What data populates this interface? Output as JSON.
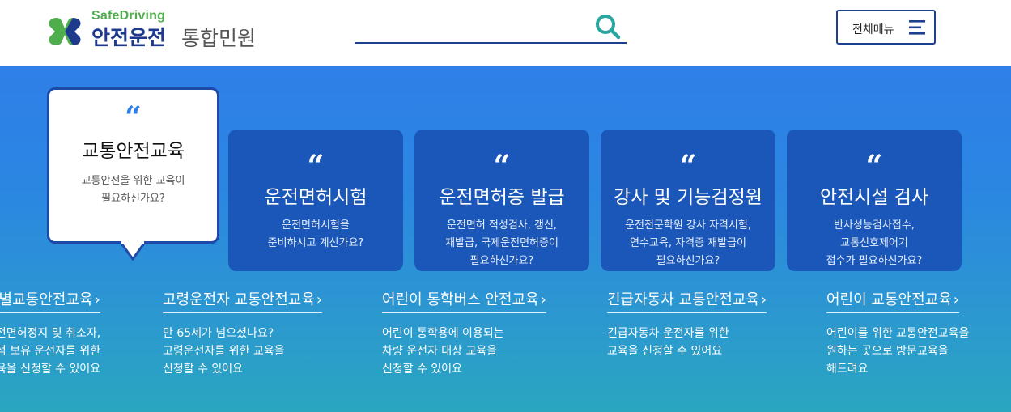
{
  "header": {
    "logo_sub": "SafeDriving",
    "logo_main": "안전운전",
    "logo_main_sub": "통합민원",
    "search_placeholder": "",
    "menu_label": "전체메뉴"
  },
  "colors": {
    "brand_navy": "#1c3f8f",
    "logo_green": "#4fae4c",
    "hero_top": "#2f7fe8",
    "hero_bottom": "#2aa6c0",
    "card_blue": "#1a57b8"
  },
  "cards": [
    {
      "quote": "“",
      "title": "교통안전교육",
      "desc": [
        "교통안전을 위한 교육이",
        "필요하신가요?"
      ],
      "active": true
    },
    {
      "quote": "“",
      "title": "운전면허시험",
      "desc": [
        "운전면허시험을",
        "준비하시고 계신가요?"
      ]
    },
    {
      "quote": "“",
      "title": "운전면허증 발급",
      "desc": [
        "운전면허 적성검사, 갱신,",
        "재발급, 국제운전면허증이",
        "필요하신가요?"
      ]
    },
    {
      "quote": "“",
      "title": "강사 및 기능검정원",
      "desc": [
        "운전전문학원 강사 자격시험,",
        "연수교육, 자격증 재발급이",
        "필요하신가요?"
      ]
    },
    {
      "quote": "“",
      "title": "안전시설 검사",
      "desc": [
        "반사성능검사접수,",
        "교통신호제어기",
        "접수가 필요하신가요?"
      ]
    }
  ],
  "education": [
    {
      "title": "특별교통안전교육",
      "chevron": "›",
      "desc": [
        "운전면허정지 및 취소자,",
        "벌점 보유 운전자를 위한",
        "교육을 신청할 수 있어요"
      ]
    },
    {
      "title": "고령운전자 교통안전교육",
      "chevron": "›",
      "desc": [
        "만 65세가 넘으셨나요?",
        "고령운전자를 위한 교육을",
        "신청할 수 있어요"
      ]
    },
    {
      "title": "어린이 통학버스 안전교육",
      "chevron": "›",
      "desc": [
        "어린이 통학용에 이용되는",
        "차량 운전자 대상 교육을",
        "신청할 수 있어요"
      ]
    },
    {
      "title": "긴급자동차 교통안전교육",
      "chevron": "›",
      "desc": [
        "긴급자동차 운전자를 위한",
        "교육을 신청할 수 있어요"
      ]
    },
    {
      "title": "어린이 교통안전교육",
      "chevron": "›",
      "desc": [
        "어린이를 위한 교통안전교육을",
        "원하는 곳으로 방문교육을",
        "해드려요"
      ]
    }
  ]
}
